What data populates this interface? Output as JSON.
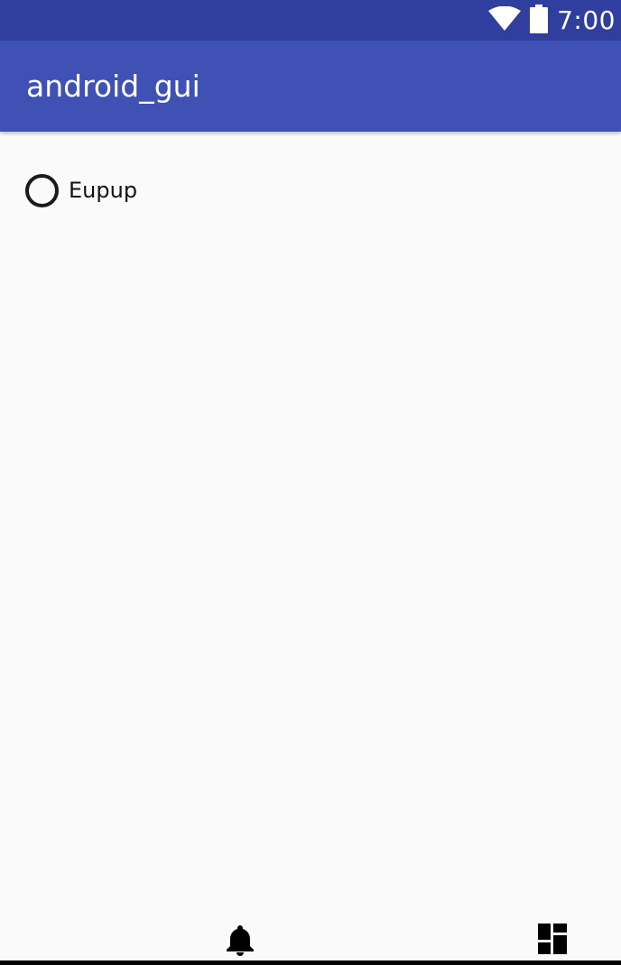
{
  "status_bar": {
    "time": "7:00",
    "icons": [
      "wifi-icon",
      "battery-icon"
    ],
    "background": "#303f9f"
  },
  "app_bar": {
    "title": "android_gui",
    "background": "#3f51b5"
  },
  "content": {
    "radio_option": {
      "label": "Eupup",
      "checked": false
    }
  },
  "bottom_nav": {
    "items": [
      {
        "icon": "notifications-bell-icon"
      },
      {
        "icon": "dashboard-icon"
      }
    ]
  }
}
